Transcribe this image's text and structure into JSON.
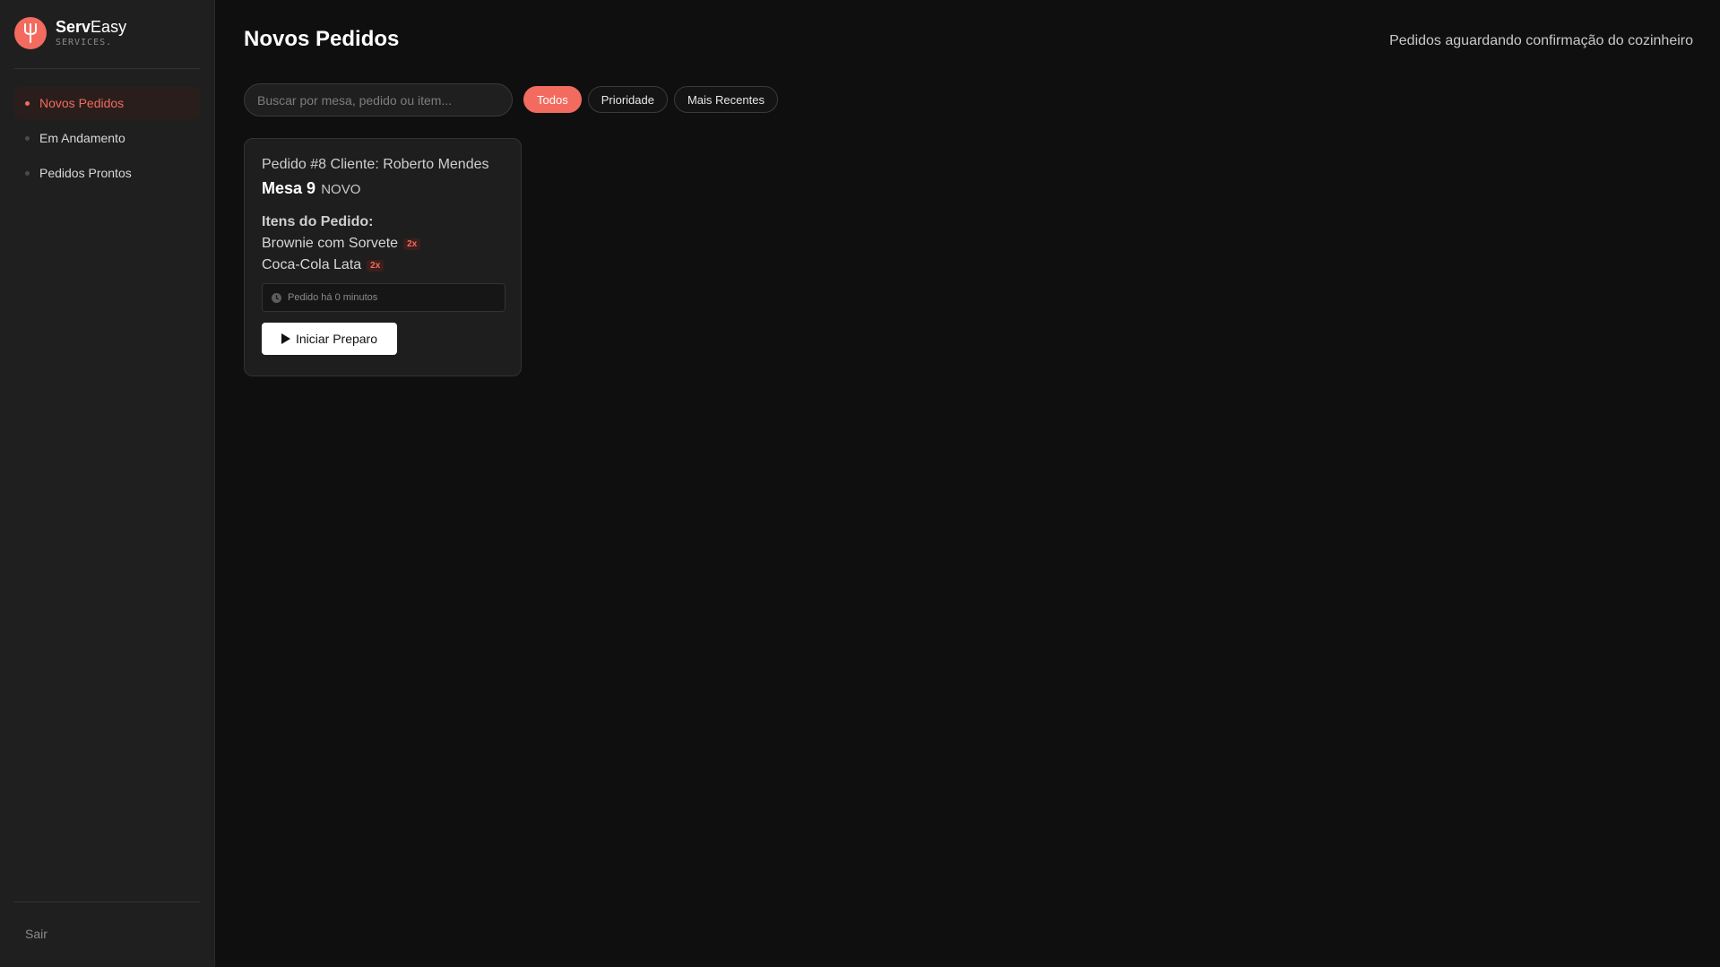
{
  "brand": {
    "name_bold": "Serv",
    "name_regular": "Easy",
    "tagline": "SERVICES.",
    "logo_icon": "fork-icon",
    "accent_color": "#f26b5e"
  },
  "sidebar": {
    "items": [
      {
        "label": "Novos Pedidos",
        "active": true
      },
      {
        "label": "Em Andamento",
        "active": false
      },
      {
        "label": "Pedidos Prontos",
        "active": false
      }
    ],
    "logout_label": "Sair"
  },
  "header": {
    "title": "Novos Pedidos",
    "subtitle": "Pedidos aguardando confirmação do cozinheiro"
  },
  "search": {
    "placeholder": "Buscar por mesa, pedido ou item...",
    "value": ""
  },
  "filters": [
    {
      "label": "Todos",
      "active": true
    },
    {
      "label": "Prioridade",
      "active": false
    },
    {
      "label": "Mais Recentes",
      "active": false
    }
  ],
  "orders": [
    {
      "order_line": "Pedido #8 Cliente: Roberto Mendes",
      "table": "Mesa 9",
      "status": "NOVO",
      "items_title": "Itens do Pedido:",
      "items": [
        {
          "name": "Brownie com Sorvete",
          "qty": "2x"
        },
        {
          "name": "Coca-Cola Lata",
          "qty": "2x"
        }
      ],
      "time_text": "Pedido há 0 minutos",
      "action_label": "Iniciar Preparo"
    }
  ]
}
